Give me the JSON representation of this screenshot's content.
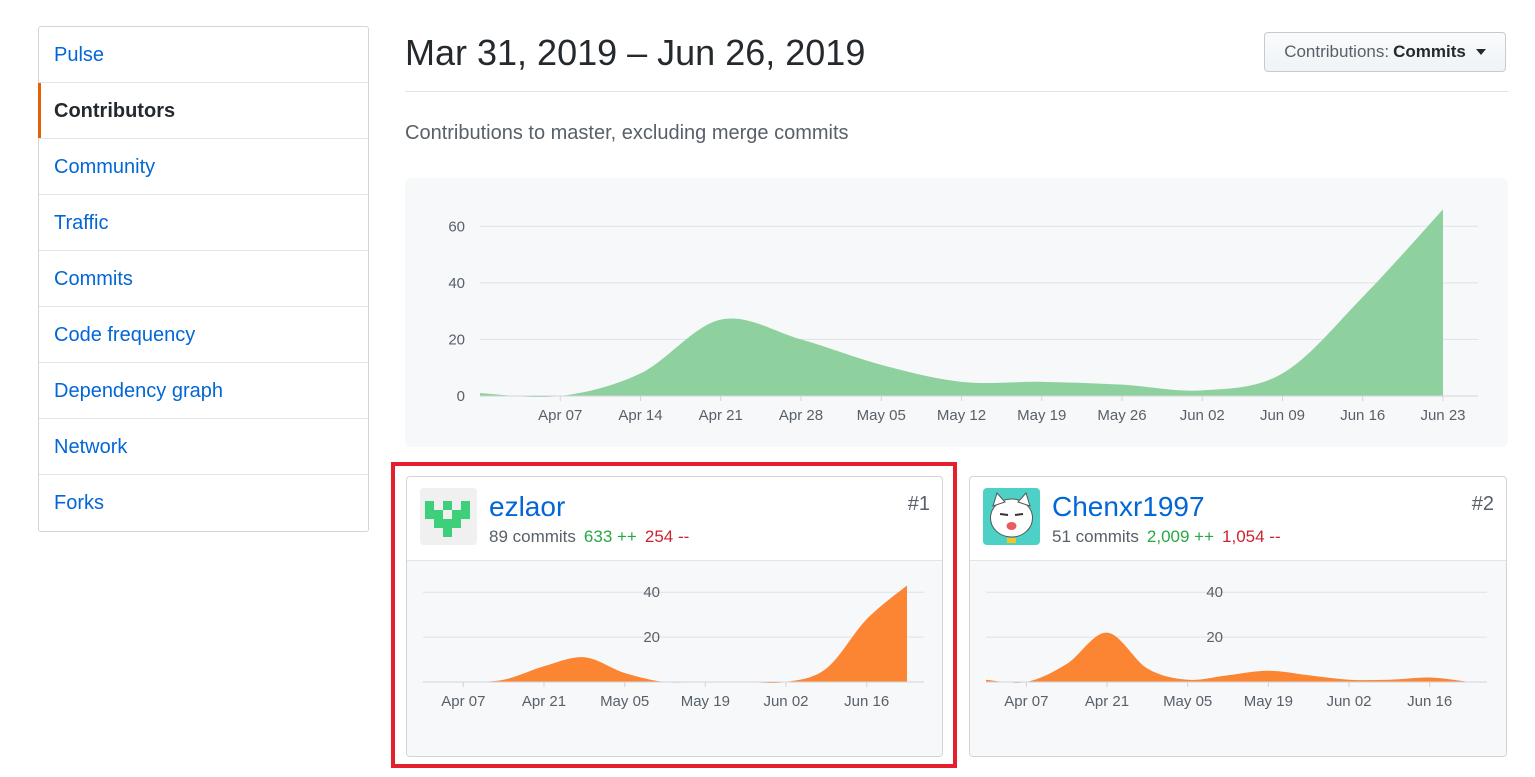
{
  "sidebar": {
    "items": [
      {
        "label": "Pulse",
        "selected": false
      },
      {
        "label": "Contributors",
        "selected": true
      },
      {
        "label": "Community",
        "selected": false
      },
      {
        "label": "Traffic",
        "selected": false
      },
      {
        "label": "Commits",
        "selected": false
      },
      {
        "label": "Code frequency",
        "selected": false
      },
      {
        "label": "Dependency graph",
        "selected": false
      },
      {
        "label": "Network",
        "selected": false
      },
      {
        "label": "Forks",
        "selected": false
      }
    ]
  },
  "header": {
    "date_range": "Mar 31, 2019 – Jun 26, 2019",
    "contributions_label": "Contributions:",
    "contributions_value": "Commits",
    "subtitle": "Contributions to master, excluding merge commits"
  },
  "colors": {
    "main_area": "#8fd19e",
    "contributor_area": "#fb8532",
    "link": "#0366d6",
    "additions": "#28a745",
    "deletions": "#cb2431",
    "selected_accent": "#e36209",
    "highlight_border": "#e3202c"
  },
  "chart_data": [
    {
      "type": "area",
      "title": "",
      "x": [
        "2019-03-31",
        "2019-04-07",
        "2019-04-14",
        "2019-04-21",
        "2019-04-28",
        "2019-05-05",
        "2019-05-12",
        "2019-05-19",
        "2019-05-26",
        "2019-06-02",
        "2019-06-09",
        "2019-06-16",
        "2019-06-23"
      ],
      "values": [
        1,
        0,
        8,
        27,
        20,
        11,
        5,
        5,
        4,
        2,
        8,
        35,
        66
      ],
      "x_tick_labels": [
        "Apr 07",
        "Apr 14",
        "Apr 21",
        "Apr 28",
        "May 05",
        "May 12",
        "May 19",
        "May 26",
        "Jun 02",
        "Jun 09",
        "Jun 16",
        "Jun 23"
      ],
      "y_ticks": [
        0,
        20,
        40,
        60
      ],
      "ylim": [
        0,
        70
      ],
      "grid": true
    },
    {
      "type": "area",
      "title": "",
      "x": [
        "2019-03-31",
        "2019-04-07",
        "2019-04-14",
        "2019-04-21",
        "2019-04-28",
        "2019-05-05",
        "2019-05-12",
        "2019-05-19",
        "2019-05-26",
        "2019-06-02",
        "2019-06-09",
        "2019-06-16",
        "2019-06-23"
      ],
      "values": [
        0,
        0,
        1,
        7,
        11,
        4,
        0,
        0,
        0,
        0,
        6,
        28,
        43
      ],
      "x_tick_labels": [
        "Apr 07",
        "Apr 21",
        "May 05",
        "May 19",
        "Jun 02",
        "Jun 16"
      ],
      "y_ticks": [
        20,
        40
      ],
      "ylim": [
        0,
        45
      ],
      "grid": true
    },
    {
      "type": "area",
      "title": "",
      "x": [
        "2019-03-31",
        "2019-04-07",
        "2019-04-14",
        "2019-04-21",
        "2019-04-28",
        "2019-05-05",
        "2019-05-12",
        "2019-05-19",
        "2019-05-26",
        "2019-06-02",
        "2019-06-09",
        "2019-06-16",
        "2019-06-23"
      ],
      "values": [
        1,
        0,
        8,
        22,
        6,
        1,
        3,
        5,
        3,
        1,
        1,
        2,
        0
      ],
      "x_tick_labels": [
        "Apr 07",
        "Apr 21",
        "May 05",
        "May 19",
        "Jun 02",
        "Jun 16"
      ],
      "y_ticks": [
        20,
        40
      ],
      "ylim": [
        0,
        45
      ],
      "grid": true
    }
  ],
  "contributors": [
    {
      "rank": "#1",
      "username": "ezlaor",
      "commits": "89 commits",
      "additions": "633 ++",
      "deletions": "254 --"
    },
    {
      "rank": "#2",
      "username": "Chenxr1997",
      "commits": "51 commits",
      "additions": "2,009 ++",
      "deletions": "1,054 --"
    }
  ]
}
